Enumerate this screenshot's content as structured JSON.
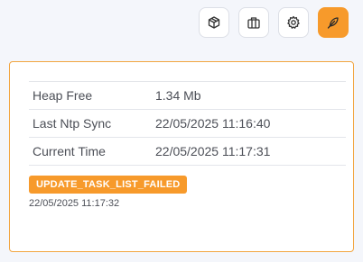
{
  "toolbar": {
    "buttons": [
      {
        "icon": "cube-icon",
        "active": false
      },
      {
        "icon": "briefcase-icon",
        "active": false
      },
      {
        "icon": "gear-icon",
        "active": false
      },
      {
        "icon": "feather-icon",
        "active": true
      }
    ],
    "accent_color": "#f79a2b"
  },
  "info": {
    "rows": [
      {
        "label": "Heap Free",
        "value": "1.34 Mb"
      },
      {
        "label": "Last Ntp Sync",
        "value": "22/05/2025 11:16:40"
      },
      {
        "label": "Current Time",
        "value": "22/05/2025 11:17:31"
      }
    ]
  },
  "status": {
    "badge": "UPDATE_TASK_LIST_FAILED",
    "timestamp": "22/05/2025 11:17:32",
    "badge_color": "#f79a2b"
  }
}
